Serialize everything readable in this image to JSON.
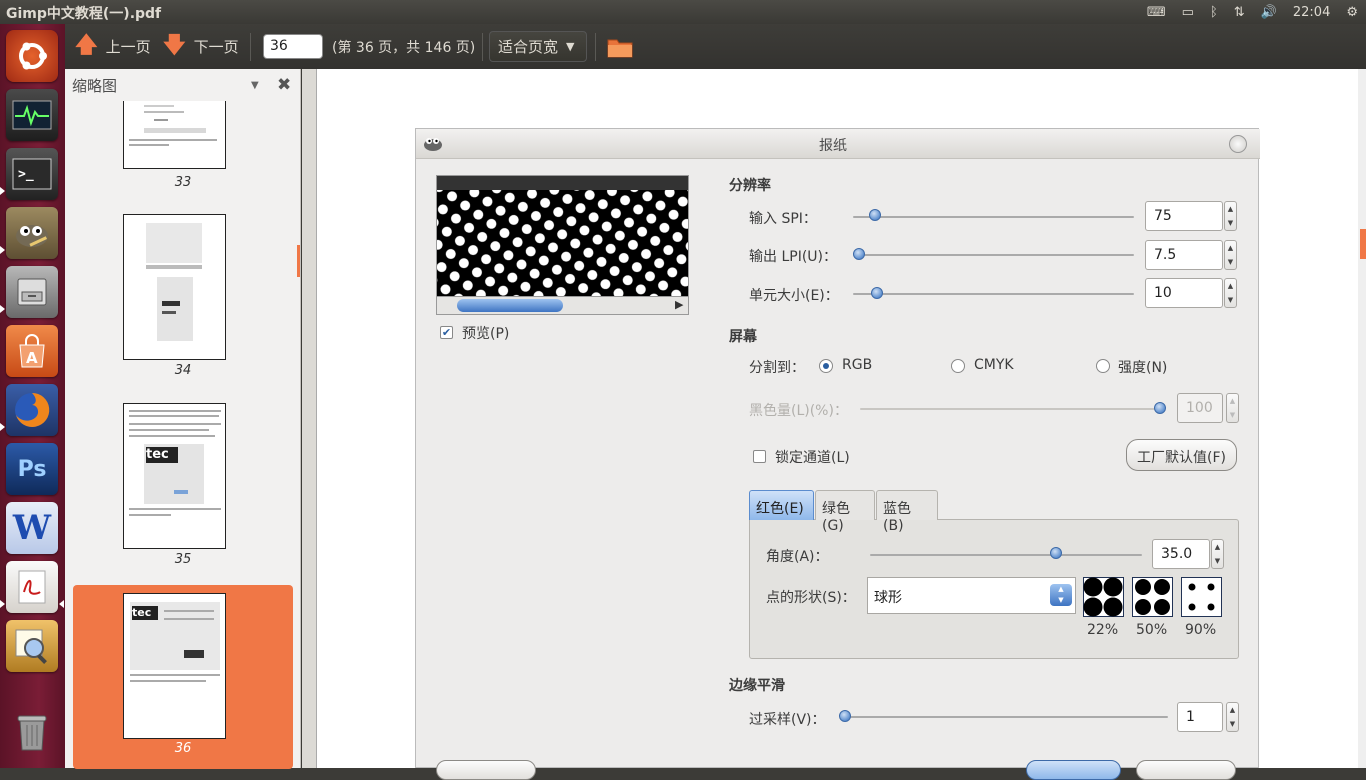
{
  "topbar": {
    "window_title": "Gimp中文教程(一).pdf",
    "clock": "22:04"
  },
  "launcher": {
    "items": [
      {
        "name": "ubuntu-home",
        "color": "#d8502a"
      },
      {
        "name": "system-monitor",
        "color": "#2f2f2f"
      },
      {
        "name": "terminal",
        "color": "#2b2b2b"
      },
      {
        "name": "gimp",
        "color": "#7a6a4a"
      },
      {
        "name": "file-manager",
        "color": "#8a8a8a"
      },
      {
        "name": "software-center",
        "color": "#e0662c"
      },
      {
        "name": "firefox",
        "color": "#e06a12"
      },
      {
        "name": "photoshop",
        "color": "#1c3a6e"
      },
      {
        "name": "wps-writer",
        "color": "#2456b8"
      },
      {
        "name": "pdf-reader",
        "color": "#e8e4df"
      },
      {
        "name": "image-viewer",
        "color": "#d9a23c"
      },
      {
        "name": "trash",
        "color": "#6b6b6b"
      }
    ],
    "ps_label": "Ps",
    "w_label": "W"
  },
  "toolbar": {
    "prev_label": "上一页",
    "next_label": "下一页",
    "page_value": "36",
    "page_info": "(第 36 页，共 146 页)",
    "zoom_label": "适合页宽"
  },
  "sidebar": {
    "title": "缩略图",
    "thumbs": [
      {
        "num": "33"
      },
      {
        "num": "34"
      },
      {
        "num": "35"
      },
      {
        "num": "36",
        "selected": true
      }
    ],
    "tec_label": "tec"
  },
  "dialog": {
    "title": "报纸",
    "preview_label": "预览(P)",
    "resolution": {
      "section": "分辨率",
      "input_spi_label": "输入 SPI：",
      "input_spi_value": "75",
      "output_lpi_label": "输出 LPI(U)：",
      "output_lpi_value": "7.5",
      "cell_size_label": "单元大小(E)：",
      "cell_size_value": "10"
    },
    "screen": {
      "section": "屏幕",
      "separate_label": "分割到：",
      "rgb": "RGB",
      "cmyk": "CMYK",
      "intensity": "强度(N)",
      "black_pullout_label": "黑色量(L)(%)：",
      "black_pullout_value": "100",
      "lock_channels_label": "锁定通道(L)",
      "factory_defaults": "工厂默认值(F)",
      "tabs": [
        "红色(E)",
        "绿色(G)",
        "蓝色(B)"
      ],
      "angle_label": "角度(A)：",
      "angle_value": "35.0",
      "spot_shape_label": "点的形状(S)：",
      "spot_shape_value": "球形",
      "swatches": [
        "22%",
        "50%",
        "90%"
      ]
    },
    "antialiasing": {
      "section": "边缘平滑",
      "oversample_label": "过采样(V)：",
      "oversample_value": "1"
    }
  }
}
